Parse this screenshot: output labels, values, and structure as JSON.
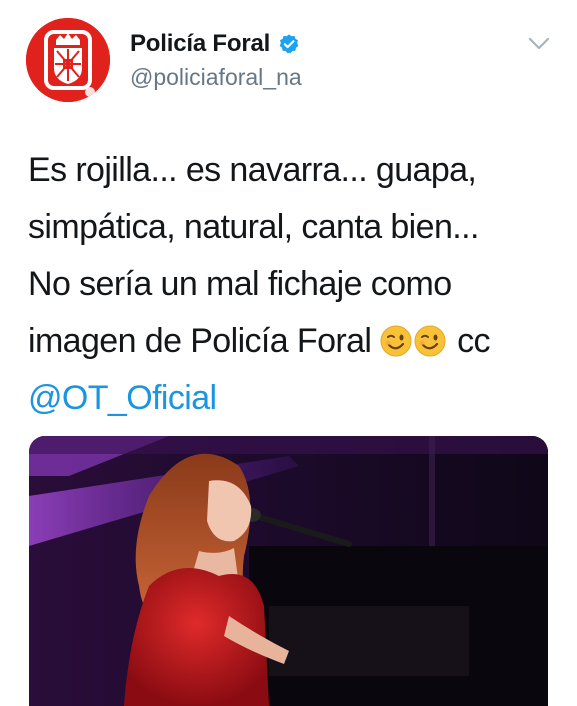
{
  "account": {
    "display_name": "Policía Foral",
    "handle": "@policiaforal_na",
    "avatar_icon": "navarra-coat-of-arms-icon",
    "verified_icon": "verified-badge-icon",
    "menu_icon": "chevron-down-icon"
  },
  "tweet": {
    "lines": [
      "Es rojilla... es navarra... guapa,",
      "simpática, natural, canta bien...",
      "No sería un mal fichaje como",
      "imagen de Policía Foral"
    ],
    "after_emoji": "cc",
    "emoji": [
      "winking-face-emoji",
      "winking-face-emoji"
    ],
    "mention": "@OT_Oficial"
  },
  "media": {
    "type": "photo",
    "subject": "singer-at-piano-photo"
  },
  "colors": {
    "brand_red": "#e1211c",
    "link_blue": "#1b95e0",
    "text": "#14171a",
    "secondary_text": "#657786"
  }
}
